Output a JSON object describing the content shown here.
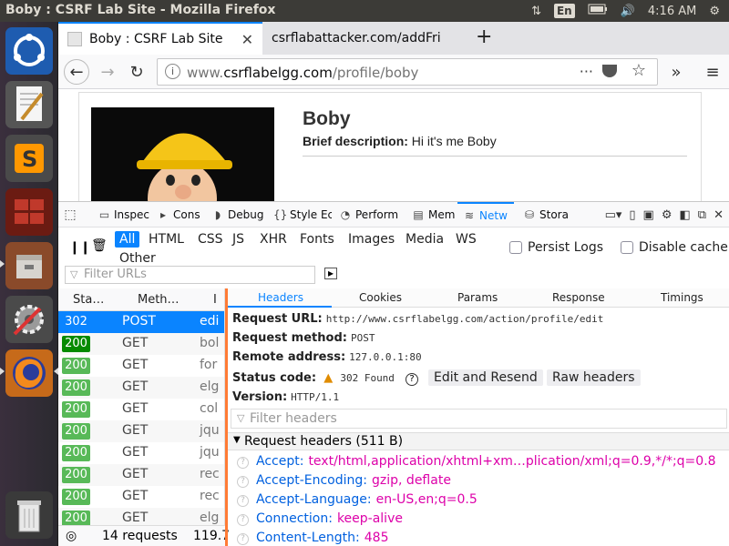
{
  "topbar": {
    "window_title": "Boby : CSRF Lab Site - Mozilla Firefox",
    "keyboard_layout": "En",
    "time": "4:16 AM"
  },
  "browser": {
    "tabs": [
      {
        "label": "Boby : CSRF Lab Site",
        "active": true
      },
      {
        "label": "csrflabattacker.com/addFri",
        "active": false
      }
    ],
    "url_prefix": "www.",
    "url_domain": "csrflabelgg.com",
    "url_path": "/profile/boby"
  },
  "page": {
    "name": "Boby",
    "brief_label": "Brief description:",
    "brief_value": "Hi it's me Boby"
  },
  "devtools": {
    "tools": [
      {
        "label": "Inspec",
        "icon": "inspector-icon"
      },
      {
        "label": "Cons",
        "icon": "console-icon"
      },
      {
        "label": "Debug",
        "icon": "debugger-icon"
      },
      {
        "label": "Style Ec",
        "icon": "style-editor-icon"
      },
      {
        "label": "Perform",
        "icon": "performance-icon"
      },
      {
        "label": "Mem",
        "icon": "memory-icon"
      },
      {
        "label": "Netw",
        "icon": "network-icon"
      },
      {
        "label": "Stora",
        "icon": "storage-icon"
      }
    ],
    "filter_types": [
      "All",
      "HTML",
      "CSS",
      "JS",
      "XHR",
      "Fonts",
      "Images",
      "Media",
      "WS",
      "Other"
    ],
    "persist_logs": "Persist Logs",
    "disable_cache": "Disable cache",
    "filter_urls_placeholder": "Filter URLs",
    "columns": {
      "status": "Sta…",
      "method": "Meth…",
      "file": "I"
    },
    "requests": [
      {
        "status": "302",
        "method": "POST",
        "file": "edi",
        "color": "#0a84ff"
      },
      {
        "status": "200",
        "method": "GET",
        "file": "bol",
        "color": "#058b00"
      },
      {
        "status": "200",
        "method": "GET",
        "file": "for",
        "color": "#58b958"
      },
      {
        "status": "200",
        "method": "GET",
        "file": "elg",
        "color": "#58b958"
      },
      {
        "status": "200",
        "method": "GET",
        "file": "col",
        "color": "#58b958"
      },
      {
        "status": "200",
        "method": "GET",
        "file": "jqu",
        "color": "#58b958"
      },
      {
        "status": "200",
        "method": "GET",
        "file": "jqu",
        "color": "#58b958"
      },
      {
        "status": "200",
        "method": "GET",
        "file": "rec",
        "color": "#58b958"
      },
      {
        "status": "200",
        "method": "GET",
        "file": "rec",
        "color": "#58b958"
      },
      {
        "status": "200",
        "method": "GET",
        "file": "elg",
        "color": "#58b958"
      }
    ],
    "footer_count": "14 requests",
    "footer_size": "119.7",
    "detail_tabs": [
      "Headers",
      "Cookies",
      "Params",
      "Response",
      "Timings"
    ],
    "request_url_label": "Request URL:",
    "request_url": "http://www.csrflabelgg.com/action/profile/edit",
    "request_method_label": "Request method:",
    "request_method": "POST",
    "remote_address_label": "Remote address:",
    "remote_address": "127.0.0.1:80",
    "status_code_label": "Status code:",
    "status_code": "302 Found",
    "edit_resend": "Edit and Resend",
    "raw_headers": "Raw headers",
    "version_label": "Version:",
    "version": "HTTP/1.1",
    "filter_headers_placeholder": "Filter headers",
    "request_headers_title": "Request headers (511 B)",
    "headers": [
      {
        "name": "Accept:",
        "value": "text/html,application/xhtml+xm…plication/xml;q=0.9,*/*;q=0.8"
      },
      {
        "name": "Accept-Encoding:",
        "value": "gzip, deflate"
      },
      {
        "name": "Accept-Language:",
        "value": "en-US,en;q=0.5"
      },
      {
        "name": "Connection:",
        "value": "keep-alive"
      },
      {
        "name": "Content-Length:",
        "value": "485"
      }
    ]
  }
}
